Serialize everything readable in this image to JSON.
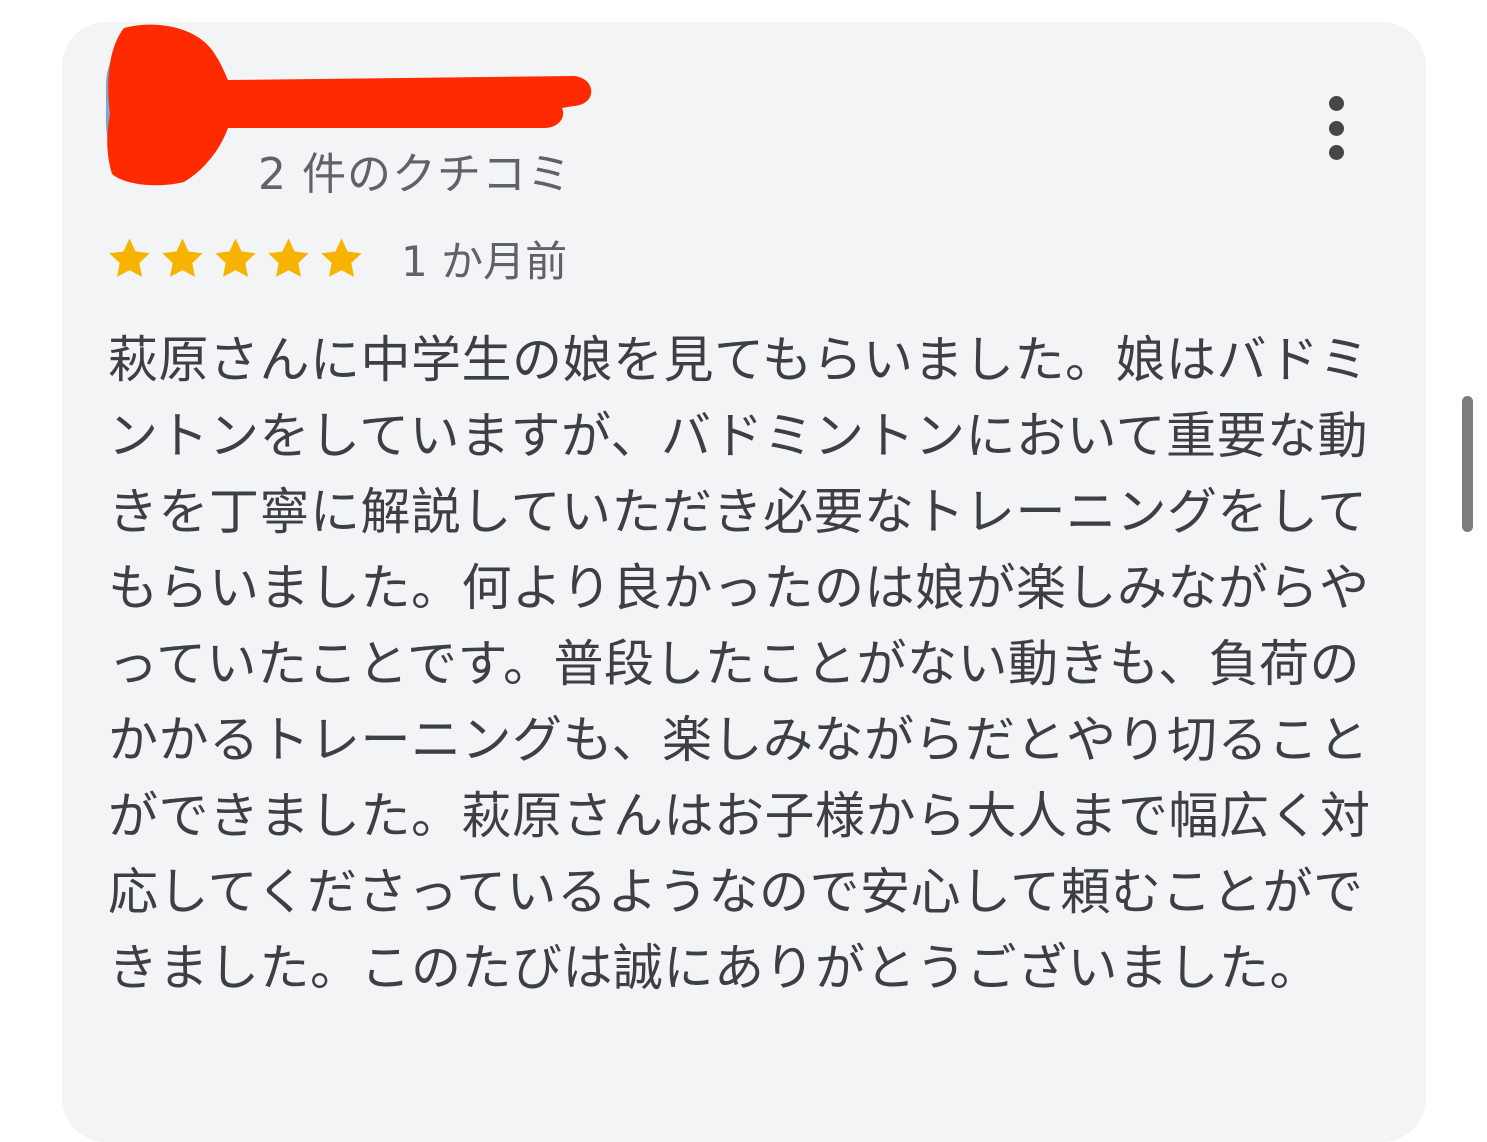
{
  "reviewer": {
    "review_count": "2 件のクチコミ"
  },
  "review": {
    "rating": 5,
    "max_rating": 5,
    "time_ago": "1 か月前",
    "body": "萩原さんに中学生の娘を見てもらいました。娘はバドミントンをしていますが、バドミントンにおいて重要な動きを丁寧に解説していただき必要なトレーニングをしてもらいました。何より良かったのは娘が楽しみながらやっていたことです。普段したことがない動きも、負荷のかかるトレーニングも、楽しみながらだとやり切ることができました。萩原さんはお子様から大人まで幅広く対応してくださっているようなので安心して頼むことができました。このたびは誠にありがとうございました。"
  },
  "icons": {
    "star": "star-icon",
    "more": "more-vert-icon",
    "avatar": "avatar"
  },
  "colors": {
    "card_background": "#f3f4f6",
    "star": "#f6b400",
    "redaction": "#ff2a00",
    "text_primary": "#3c4043",
    "text_secondary": "#5f6368"
  }
}
